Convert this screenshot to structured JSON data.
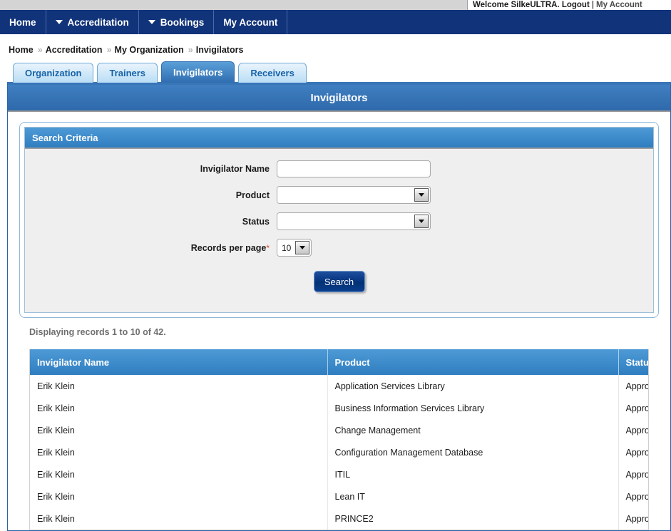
{
  "topbar": {
    "welcome_text": "Welcome SilkeULTRA. Logout",
    "separator": "|",
    "my_account_link": "My Account"
  },
  "nav": {
    "items": [
      {
        "label": "Home",
        "has_caret": false
      },
      {
        "label": "Accreditation",
        "has_caret": true
      },
      {
        "label": "Bookings",
        "has_caret": true
      },
      {
        "label": "My Account",
        "has_caret": false
      }
    ]
  },
  "breadcrumb": {
    "separator": "»",
    "items": [
      "Home",
      "Accreditation",
      "My Organization",
      "Invigilators"
    ]
  },
  "tabs": [
    {
      "label": "Organization",
      "active": false
    },
    {
      "label": "Trainers",
      "active": false
    },
    {
      "label": "Invigilators",
      "active": true
    },
    {
      "label": "Receivers",
      "active": false
    }
  ],
  "panel": {
    "title": "Invigilators"
  },
  "search": {
    "header": "Search Criteria",
    "fields": {
      "invigilator_name": {
        "label": "Invigilator Name",
        "value": "",
        "placeholder": ""
      },
      "product": {
        "label": "Product",
        "value": "",
        "required": false
      },
      "status": {
        "label": "Status",
        "value": "",
        "required": false
      },
      "records_per_page": {
        "label": "Records per page",
        "value": "10",
        "required": true,
        "required_marker": "*"
      }
    },
    "submit_label": "Search"
  },
  "results": {
    "info": "Displaying records 1 to 10 of 42.",
    "columns": [
      "Invigilator Name",
      "Product",
      "Status"
    ],
    "rows": [
      [
        "Erik Klein",
        "Application Services Library",
        "Approved"
      ],
      [
        "Erik Klein",
        "Business Information Services Library",
        "Approved"
      ],
      [
        "Erik Klein",
        "Change Management",
        "Approved"
      ],
      [
        "Erik Klein",
        "Configuration Management Database",
        "Approved"
      ],
      [
        "Erik Klein",
        "ITIL",
        "Approved"
      ],
      [
        "Erik Klein",
        "Lean IT",
        "Approved"
      ],
      [
        "Erik Klein",
        "PRINCE2",
        "Approved"
      ]
    ]
  },
  "colors": {
    "nav_bg": "#11337a",
    "panel_header": "#2e69ab",
    "section_header": "#2f7ec0",
    "tab_active": "#2f6db0",
    "tab_inactive": "#b9ddf5",
    "button_primary": "#06357f",
    "required_star": "#e04a2f",
    "page_bg": "#ffffff",
    "field_bg": "#efefef"
  }
}
